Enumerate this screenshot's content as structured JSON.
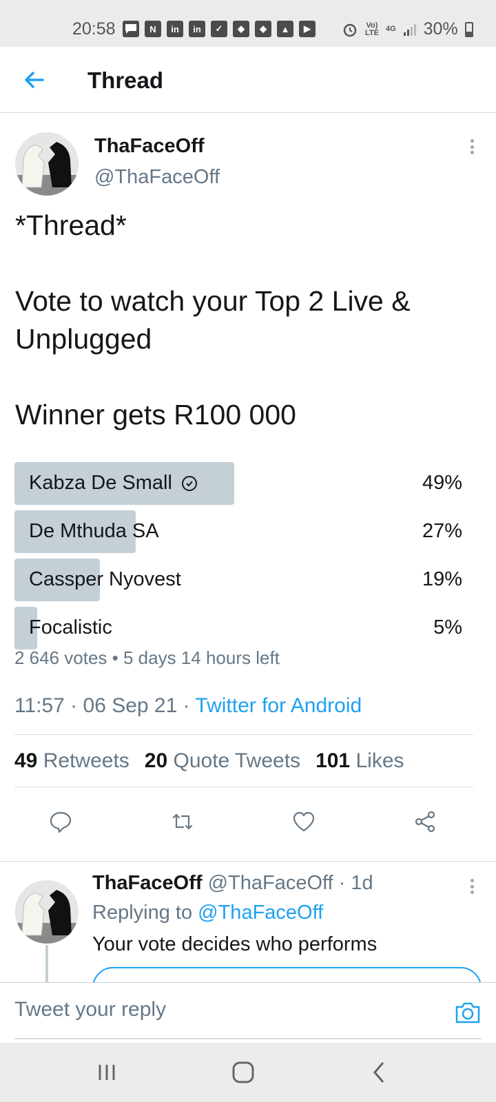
{
  "status_bar": {
    "time": "20:58",
    "battery": "30%",
    "network_top": "Vo)",
    "network_bottom": "LTE",
    "signal_type": "4G",
    "notif_icons": [
      "message-icon",
      "n-icon",
      "linkedin-icon",
      "linkedin-icon",
      "check-icon",
      "shield-icon",
      "shield-icon",
      "image-icon",
      "youtube-icon"
    ]
  },
  "header": {
    "title": "Thread"
  },
  "tweet": {
    "name": "ThaFaceOff",
    "handle": "@ThaFaceOff",
    "text": "*Thread*\n\nVote to watch your Top 2 Live & Unplugged\n\nWinner gets R100 000",
    "poll": {
      "options": [
        {
          "label": "Kabza De Small",
          "percent_text": "49%",
          "percent": 49,
          "winner": true
        },
        {
          "label": "De Mthuda SA",
          "percent_text": "27%",
          "percent": 27,
          "winner": false
        },
        {
          "label": "Cassper Nyovest",
          "percent_text": "19%",
          "percent": 19,
          "winner": false
        },
        {
          "label": "Focalistic",
          "percent_text": "5%",
          "percent": 5,
          "winner": false
        }
      ],
      "meta": "2 646 votes • 5 days 14 hours left"
    },
    "time": "11:57 · 06 Sep 21 · ",
    "source": "Twitter for Android",
    "stats": {
      "retweets_count": "49",
      "retweets_label": "Retweets",
      "quotes_count": "20",
      "quotes_label": "Quote Tweets",
      "likes_count": "101",
      "likes_label": "Likes"
    }
  },
  "reply": {
    "name": "ThaFaceOff",
    "handle_time": " @ThaFaceOff · 1d",
    "replying_prefix": "Replying to ",
    "replying_mention": "@ThaFaceOff",
    "text": "Your vote decides who performs"
  },
  "compose": {
    "placeholder": "Tweet your reply"
  },
  "colors": {
    "accent": "#1da1f2",
    "poll_fill": "#c4cfd6",
    "secondary_text": "#657786"
  }
}
